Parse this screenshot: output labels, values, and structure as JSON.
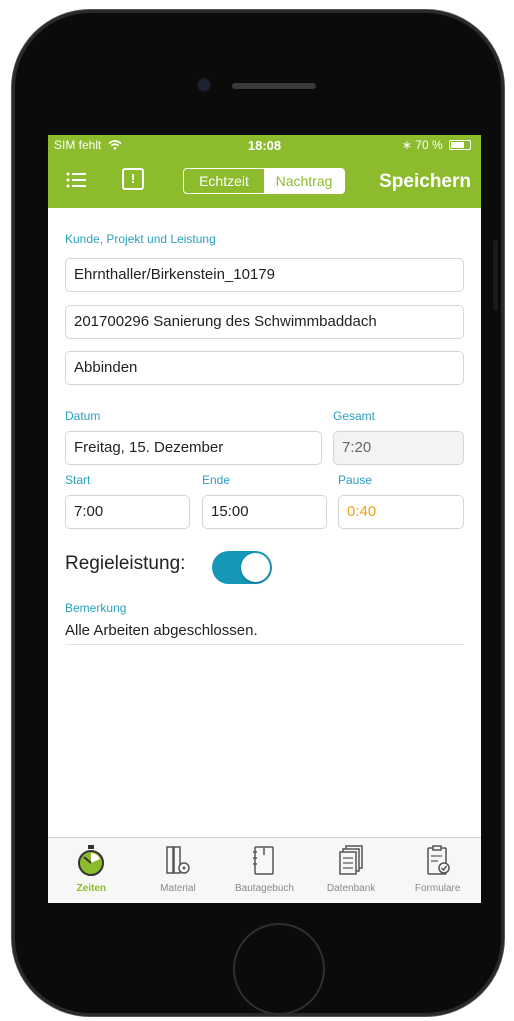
{
  "status_bar": {
    "carrier": "SIM fehlt",
    "time": "18:08",
    "battery": "70 %"
  },
  "navbar": {
    "segment_realtime": "Echtzeit",
    "segment_later": "Nachtrag",
    "save_label": "Speichern",
    "accent_color": "#8cbc2e"
  },
  "form": {
    "section_label": "Kunde, Projekt und Leistung",
    "customer": "Ehrnthaller/Birkenstein_10179",
    "project": "201700296 Sanierung des Schwimmbaddach",
    "service": "Abbinden",
    "date_label": "Datum",
    "date_value": "Freitag, 15. Dezember",
    "total_label": "Gesamt",
    "total_value": "7:20",
    "start_label": "Start",
    "start_value": "7:00",
    "end_label": "Ende",
    "end_value": "15:00",
    "pause_label": "Pause",
    "pause_value": "0:40",
    "regie_label": "Regieleistung:",
    "regie_on": true,
    "remark_label": "Bemerkung",
    "remark_value": "Alle Arbeiten abgeschlossen."
  },
  "tabbar": {
    "tabs": [
      {
        "label": "Zeiten",
        "icon": "stopwatch-icon",
        "active": true
      },
      {
        "label": "Material",
        "icon": "material-icon",
        "active": false
      },
      {
        "label": "Bautagebuch",
        "icon": "notebook-icon",
        "active": false
      },
      {
        "label": "Datenbank",
        "icon": "database-icon",
        "active": false
      },
      {
        "label": "Formulare",
        "icon": "forms-icon",
        "active": false
      }
    ]
  }
}
